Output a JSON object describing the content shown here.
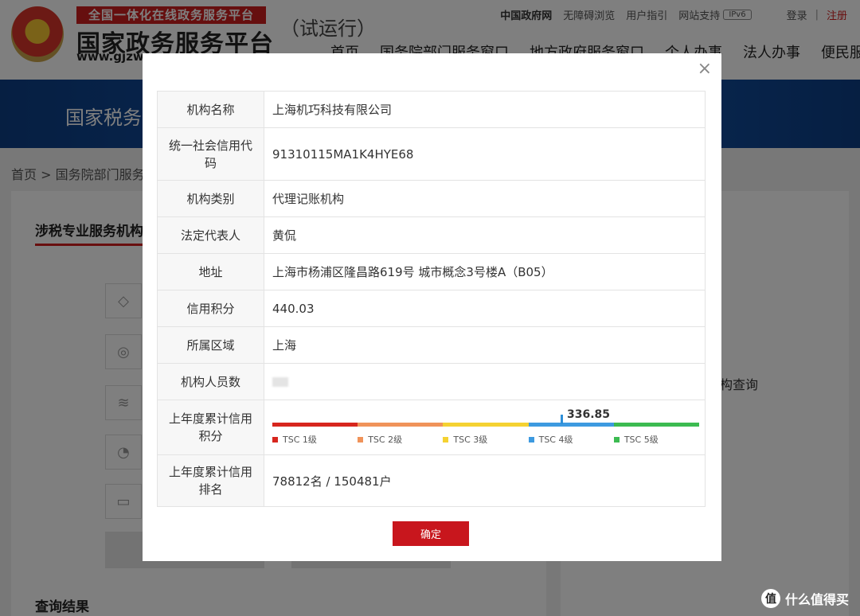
{
  "header": {
    "logo_banner": "全国一体化在线政务服务平台",
    "logo_title": "国家政务服务平台",
    "logo_url": "www.gjzw",
    "trial": "（试运行）",
    "top_links": {
      "gov": "中国政府网",
      "accessibility": "无障碍浏览",
      "guide": "用户指引",
      "site_support": "网站支持",
      "ipv6": "IPv6",
      "login": "登录",
      "separator": "|",
      "register": "注册"
    },
    "nav": [
      "首页",
      "国务院部门服务窗口",
      "地方政府服务窗口",
      "个人办事",
      "法人办事",
      "便民服务"
    ]
  },
  "banner": {
    "title": "国家税务"
  },
  "breadcrumb": "首页 > 国务院部门服务",
  "left": {
    "section_title": "涉税专业服务机构",
    "results_title": "查询结果"
  },
  "right": {
    "text": "构查询"
  },
  "modal": {
    "close": "×",
    "rows": [
      {
        "label": "机构名称",
        "value": "上海机巧科技有限公司"
      },
      {
        "label": "统一社会信用代码",
        "value": "91310115MA1K4HYE68"
      },
      {
        "label": "机构类别",
        "value": "代理记账机构"
      },
      {
        "label": "法定代表人",
        "value": "黄侃"
      },
      {
        "label": "地址",
        "value": "上海市杨浦区隆昌路619号 城市概念3号楼A（B05）"
      },
      {
        "label": "信用积分",
        "value": "440.03"
      },
      {
        "label": "所属区域",
        "value": "上海"
      },
      {
        "label": "机构人员数",
        "value": ""
      },
      {
        "label": "上年度累计信用积分",
        "value": ""
      },
      {
        "label": "上年度累计信用排名",
        "value": "78812名 / 150481户"
      }
    ],
    "ok_label": "确定"
  },
  "chart_data": {
    "type": "bar",
    "value": 336.85,
    "position_fraction": 0.675,
    "levels": [
      {
        "name": "TSC 1级",
        "color": "#d7261e"
      },
      {
        "name": "TSC 2级",
        "color": "#f0935a"
      },
      {
        "name": "TSC 3级",
        "color": "#f5d232"
      },
      {
        "name": "TSC 4级",
        "color": "#3d9ae0"
      },
      {
        "name": "TSC 5级",
        "color": "#3cbb51"
      }
    ]
  },
  "watermark": {
    "logo": "值",
    "text": "什么值得买"
  }
}
